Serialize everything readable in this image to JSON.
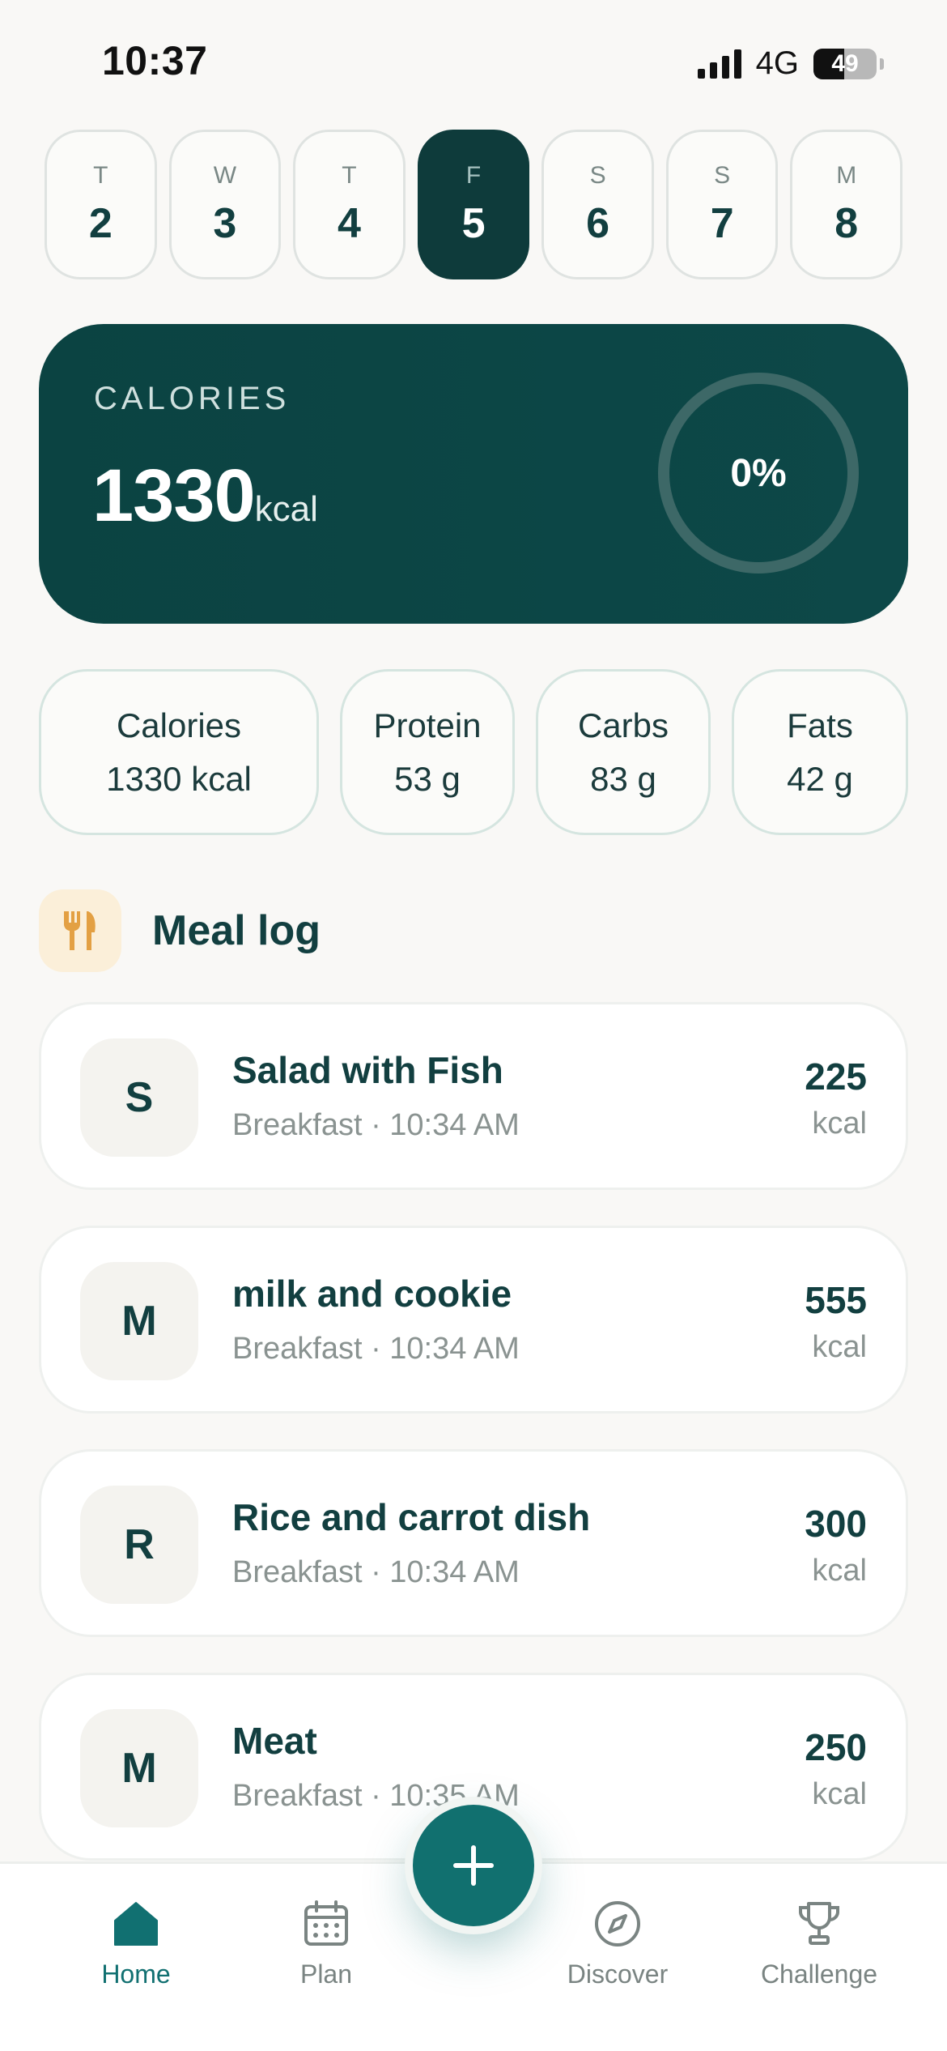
{
  "status_bar": {
    "time": "10:37",
    "network": "4G",
    "battery": "49",
    "battery_level": 0.49
  },
  "days": [
    {
      "dow": "T",
      "num": "2"
    },
    {
      "dow": "W",
      "num": "3"
    },
    {
      "dow": "T",
      "num": "4"
    },
    {
      "dow": "F",
      "num": "5"
    },
    {
      "dow": "S",
      "num": "6"
    },
    {
      "dow": "S",
      "num": "7"
    },
    {
      "dow": "M",
      "num": "8"
    }
  ],
  "selected_day": "5",
  "calories_card": {
    "label": "CALORIES",
    "value": "1330",
    "unit": "kcal",
    "progress_text": "0%",
    "progress": 0
  },
  "macros": [
    {
      "label": "Calories",
      "value": "1330 kcal"
    },
    {
      "label": "Protein",
      "value": "53 g"
    },
    {
      "label": "Carbs",
      "value": "83 g"
    },
    {
      "label": "Fats",
      "value": "42 g"
    }
  ],
  "meal_log": {
    "title": "Meal log",
    "icon": "fork-knife-icon",
    "items": [
      {
        "initial": "S",
        "name": "Salad with Fish",
        "meta": "Breakfast · 10:34 AM",
        "kcal": "225",
        "unit": "kcal"
      },
      {
        "initial": "M",
        "name": "milk and cookie",
        "meta": "Breakfast · 10:34 AM",
        "kcal": "555",
        "unit": "kcal"
      },
      {
        "initial": "R",
        "name": "Rice and carrot dish",
        "meta": "Breakfast · 10:34 AM",
        "kcal": "300",
        "unit": "kcal"
      },
      {
        "initial": "M",
        "name": "Meat",
        "meta": "Breakfast · 10:35 AM",
        "kcal": "250",
        "unit": "kcal"
      }
    ]
  },
  "nav": {
    "items": [
      {
        "label": "Home",
        "icon": "home-icon",
        "active": true
      },
      {
        "label": "Plan",
        "icon": "calendar-icon",
        "active": false
      },
      {
        "label": "Discover",
        "icon": "compass-icon",
        "active": false
      },
      {
        "label": "Challenge",
        "icon": "trophy-icon",
        "active": false
      }
    ],
    "add_icon": "plus-icon"
  },
  "colors": {
    "primary_dark": "#0e3b3b",
    "accent": "#117071",
    "background": "#f9f8f6",
    "meal_icon_bg": "#fbefd9",
    "meal_icon_fg": "#e3a043"
  }
}
